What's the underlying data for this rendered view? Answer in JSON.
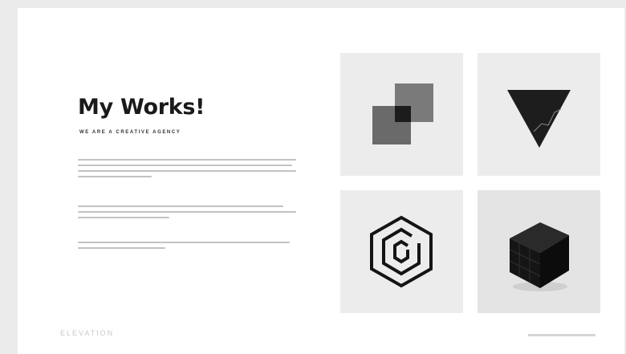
{
  "slide": {
    "title": "My Works!",
    "subtitle": "WE ARE A CREATIVE AGENCY",
    "brand": "ELEVATION"
  },
  "works": [
    {
      "icon": "overlapping-squares-icon"
    },
    {
      "icon": "inverted-triangle-icon"
    },
    {
      "icon": "hexagon-logo-icon"
    },
    {
      "icon": "black-cube-icon"
    }
  ]
}
